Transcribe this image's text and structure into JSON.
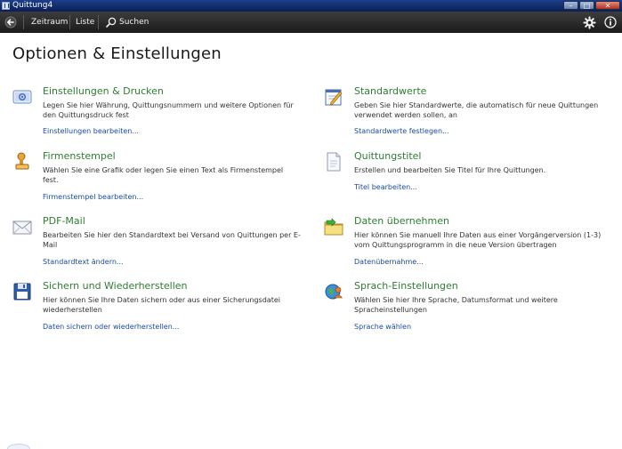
{
  "window": {
    "title": "Quittung4"
  },
  "toolbar": {
    "items": [
      {
        "label": "Zeitraum"
      },
      {
        "label": "Liste"
      },
      {
        "label": "Suchen"
      }
    ]
  },
  "page": {
    "title": "Optionen & Einstellungen"
  },
  "sections": [
    {
      "icon": "settings-print-icon",
      "title": "Einstellungen & Drucken",
      "description": "Legen Sie hier Währung, Quittungsnummern und weitere Optionen für den Quittungsdruck fest",
      "link": "Einstellungen bearbeiten..."
    },
    {
      "icon": "pencil-notepad-icon",
      "title": "Standardwerte",
      "description": "Geben Sie hier Standardwerte, die automatisch für neue Quittungen verwendet werden sollen, an",
      "link": "Standardwerte festlegen..."
    },
    {
      "icon": "stamp-icon",
      "title": "Firmenstempel",
      "description": "Wählen Sie eine Grafik oder legen Sie einen Text als Firmenstempel fest.",
      "link": "Firmenstempel bearbeiten..."
    },
    {
      "icon": "document-icon",
      "title": "Quittungstitel",
      "description": "Erstellen und bearbeiten Sie Titel für Ihre Quittungen.",
      "link": "Titel bearbeiten..."
    },
    {
      "icon": "envelope-icon",
      "title": "PDF-Mail",
      "description": "Bearbeiten Sie hier den Standardtext bei Versand von Quittungen per E-Mail",
      "link": "Standardtext ändern..."
    },
    {
      "icon": "folder-import-icon",
      "title": "Daten übernehmen",
      "description": "Hier können Sie manuell Ihre Daten aus einer Vorgängerversion (1-3) vom Quittungsprogramm in die neue Version übertragen",
      "link": "Datenübernahme..."
    },
    {
      "icon": "floppy-disk-icon",
      "title": "Sichern und Wiederherstellen",
      "description": "Hier können Sie Ihre Daten sichern oder aus einer Sicherungsdatei wiederherstellen",
      "link": "Daten sichern oder wiederherstellen..."
    },
    {
      "icon": "globe-user-icon",
      "title": "Sprach-Einstellungen",
      "description": "Wählen Sie hier Ihre Sprache, Datumsformat und weitere Spracheinstellungen",
      "link": "Sprache wählen"
    }
  ],
  "colors": {
    "section_title": "#2e7d32",
    "link": "#1a4a9c",
    "toolbar_bg": "#262626",
    "titlebar_bg": "#163273"
  }
}
